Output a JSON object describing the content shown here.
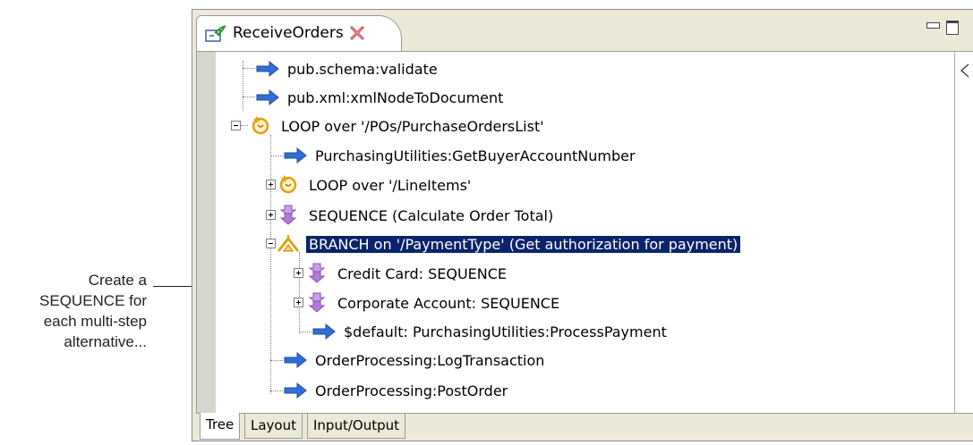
{
  "annotation": {
    "lines": [
      "Create a",
      "SEQUENCE for",
      "each multi-step",
      "alternative..."
    ]
  },
  "editor": {
    "tab_title": "ReceiveOrders",
    "icons": {
      "tab": "flow-service-icon",
      "close": "close-icon",
      "minimize": "minimize-icon",
      "maximize": "maximize-icon",
      "collapse": "collapse-arrow-icon"
    }
  },
  "tree": {
    "nodes": [
      {
        "label": "pub.schema:validate",
        "icon": "invoke-arrow-icon"
      },
      {
        "label": "pub.xml:xmlNodeToDocument",
        "icon": "invoke-arrow-icon"
      },
      {
        "label": "LOOP over '/POs/PurchaseOrdersList'",
        "icon": "loop-icon"
      },
      {
        "label": "PurchasingUtilities:GetBuyerAccountNumber",
        "icon": "invoke-arrow-icon"
      },
      {
        "label": "LOOP over '/LineItems'",
        "icon": "loop-icon"
      },
      {
        "label": "SEQUENCE (Calculate Order Total)",
        "icon": "sequence-icon"
      },
      {
        "label": "BRANCH on '/PaymentType' (Get authorization for payment)",
        "icon": "branch-icon",
        "selected": true
      },
      {
        "label": "Credit Card: SEQUENCE",
        "icon": "sequence-icon"
      },
      {
        "label": "Corporate Account: SEQUENCE",
        "icon": "sequence-icon"
      },
      {
        "label": "$default: PurchasingUtilities:ProcessPayment",
        "icon": "invoke-arrow-icon"
      },
      {
        "label": "OrderProcessing:LogTransaction",
        "icon": "invoke-arrow-icon"
      },
      {
        "label": "OrderProcessing:PostOrder",
        "icon": "invoke-arrow-icon"
      }
    ]
  },
  "bottom_tabs": [
    {
      "label": "Tree",
      "active": true
    },
    {
      "label": "Layout",
      "active": false
    },
    {
      "label": "Input/Output",
      "active": false
    }
  ],
  "colors": {
    "selection_bg": "#0a246a",
    "invoke_arrow": "#2f6fd6",
    "sequence_purple": "#b47ad8",
    "loop_orange": "#e3a010"
  }
}
